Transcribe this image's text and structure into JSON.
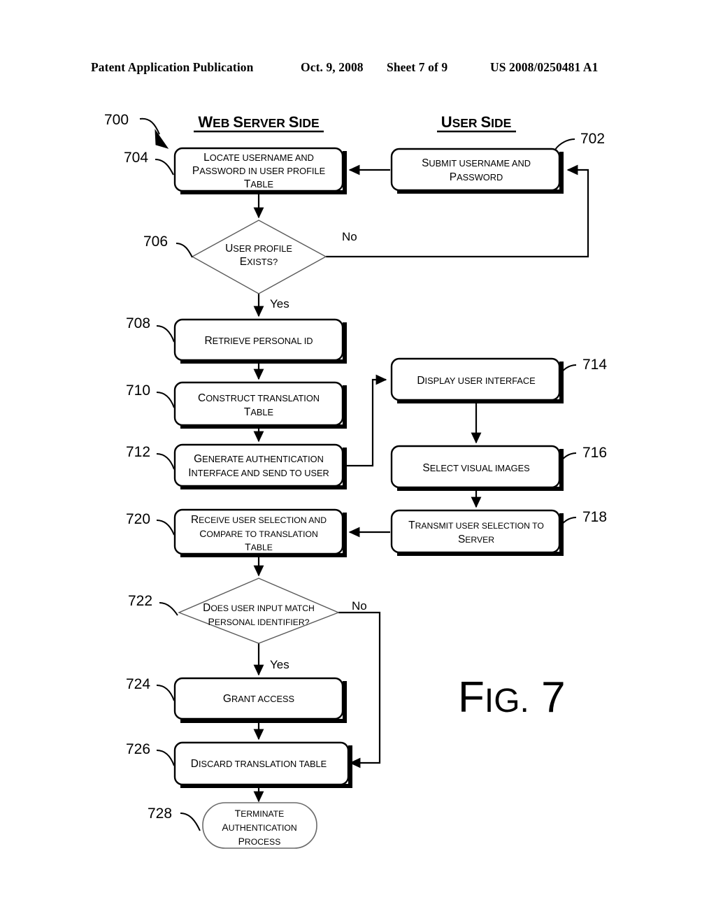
{
  "header": {
    "publication": "Patent Application Publication",
    "date": "Oct. 9, 2008",
    "sheet": "Sheet 7 of 9",
    "patent_number": "US 2008/0250481 A1"
  },
  "figure": {
    "label": "FIG. 7",
    "diagram_ref": "700",
    "lanes": [
      {
        "id": "web-server-side",
        "title": "Web Server Side"
      },
      {
        "id": "user-side",
        "title": "User Side"
      }
    ],
    "branch_labels": {
      "no_706": "No",
      "yes_706": "Yes",
      "no_722": "No",
      "yes_722": "Yes"
    },
    "nodes": [
      {
        "ref": "702",
        "type": "process",
        "lane": "user-side",
        "lines": [
          "Submit Username and",
          "Password"
        ]
      },
      {
        "ref": "704",
        "type": "process",
        "lane": "web-server-side",
        "lines": [
          "Locate Username and",
          "Password in User Profile",
          "Table"
        ]
      },
      {
        "ref": "706",
        "type": "decision",
        "lane": "web-server-side",
        "lines": [
          "User Profile",
          "Exists?"
        ]
      },
      {
        "ref": "708",
        "type": "process",
        "lane": "web-server-side",
        "lines": [
          "Retrieve Personal ID"
        ]
      },
      {
        "ref": "710",
        "type": "process",
        "lane": "web-server-side",
        "lines": [
          "Construct Translation",
          "Table"
        ]
      },
      {
        "ref": "712",
        "type": "process",
        "lane": "web-server-side",
        "lines": [
          "Generate Authentication",
          "Interface and Send to user"
        ]
      },
      {
        "ref": "714",
        "type": "process",
        "lane": "user-side",
        "lines": [
          "Display User Interface"
        ]
      },
      {
        "ref": "716",
        "type": "process",
        "lane": "user-side",
        "lines": [
          "Select Visual Images"
        ]
      },
      {
        "ref": "718",
        "type": "process",
        "lane": "user-side",
        "lines": [
          "Transmit user selection to",
          "server"
        ]
      },
      {
        "ref": "720",
        "type": "process",
        "lane": "web-server-side",
        "lines": [
          "Receive user selection and",
          "compare to translation",
          "table"
        ]
      },
      {
        "ref": "722",
        "type": "decision",
        "lane": "web-server-side",
        "lines": [
          "Does user input match",
          "personal identifier?"
        ]
      },
      {
        "ref": "724",
        "type": "process",
        "lane": "web-server-side",
        "lines": [
          "Grant Access"
        ]
      },
      {
        "ref": "726",
        "type": "process",
        "lane": "web-server-side",
        "lines": [
          "Discard Translation Table"
        ]
      },
      {
        "ref": "728",
        "type": "terminal",
        "lane": "web-server-side",
        "lines": [
          "Terminate",
          "Authentication",
          "Process"
        ]
      }
    ],
    "edges": [
      {
        "from": "702",
        "to": "704",
        "label": ""
      },
      {
        "from": "704",
        "to": "706",
        "label": ""
      },
      {
        "from": "706",
        "to": "702",
        "label": "No"
      },
      {
        "from": "706",
        "to": "708",
        "label": "Yes"
      },
      {
        "from": "708",
        "to": "710",
        "label": ""
      },
      {
        "from": "710",
        "to": "712",
        "label": ""
      },
      {
        "from": "712",
        "to": "714",
        "label": ""
      },
      {
        "from": "714",
        "to": "716",
        "label": ""
      },
      {
        "from": "716",
        "to": "718",
        "label": ""
      },
      {
        "from": "718",
        "to": "720",
        "label": ""
      },
      {
        "from": "720",
        "to": "722",
        "label": ""
      },
      {
        "from": "722",
        "to": "724",
        "label": "Yes"
      },
      {
        "from": "722",
        "to": "726",
        "label": "No"
      },
      {
        "from": "724",
        "to": "726",
        "label": ""
      },
      {
        "from": "726",
        "to": "728",
        "label": ""
      }
    ]
  },
  "colors": {
    "ink": "#000000",
    "paper": "#ffffff",
    "light_stroke": "#5a5a5a"
  }
}
